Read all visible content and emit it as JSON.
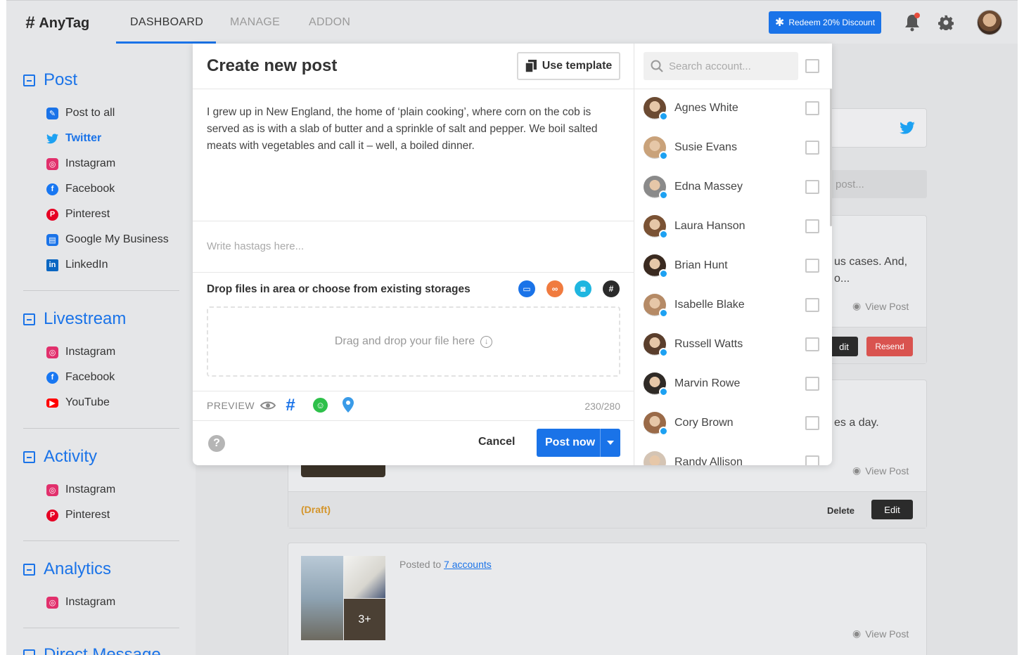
{
  "app": {
    "logo": "AnyTag",
    "tabs": [
      "DASHBOARD",
      "MANAGE",
      "ADDON"
    ],
    "redeem_label": "Redeem 20% Discount"
  },
  "sidebar": {
    "sections": [
      {
        "title": "Post",
        "items": [
          "Post to all",
          "Twitter",
          "Instagram",
          "Facebook",
          "Pinterest",
          "Google My Business",
          "LinkedIn"
        ]
      },
      {
        "title": "Livestream",
        "items": [
          "Instagram",
          "Facebook",
          "YouTube"
        ]
      },
      {
        "title": "Activity",
        "items": [
          "Instagram",
          "Pinterest"
        ]
      },
      {
        "title": "Analytics",
        "items": [
          "Instagram"
        ]
      },
      {
        "title": "Direct Message",
        "items": []
      }
    ]
  },
  "feed": {
    "partial_search": "post...",
    "card1_text": "us cases. And,",
    "card1_text2": "o...",
    "card2_text": "es a day.",
    "draft_label": "(Draft)",
    "delete_label": "Delete",
    "edit_label": "Edit",
    "edit_partial": "dit",
    "resend_label": "Resend",
    "view_post": "View Post",
    "posted_to": "Posted to",
    "accounts_link": "7 accounts",
    "more_images": "3+"
  },
  "modal": {
    "title": "Create new post",
    "use_template": "Use template",
    "post_text": "I grew up in New England, the home of ‘plain cooking’, where corn on the cob is served as is with a slab of butter and a sprinkle of salt and pepper. We boil salted meats with vegetables and call it – well, a boiled dinner.",
    "hashtags_placeholder": "Write hastags here...",
    "drop_label": "Drop files in area or choose from existing storages",
    "dropzone_text": "Drag and drop your file here",
    "preview_label": "PREVIEW",
    "char_count": "230/280",
    "cancel": "Cancel",
    "post_now": "Post now",
    "search_placeholder": "Search account...",
    "accounts": [
      "Agnes White",
      "Susie Evans",
      "Edna Massey",
      "Laura Hanson",
      "Brian Hunt",
      "Isabelle Blake",
      "Russell Watts",
      "Marvin Rowe",
      "Cory Brown",
      "Randy Allison"
    ]
  },
  "colors": {
    "accent": "#1a73e8",
    "twitter": "#1da1f2",
    "draft": "#d4952b",
    "resend": "#d9534f"
  }
}
